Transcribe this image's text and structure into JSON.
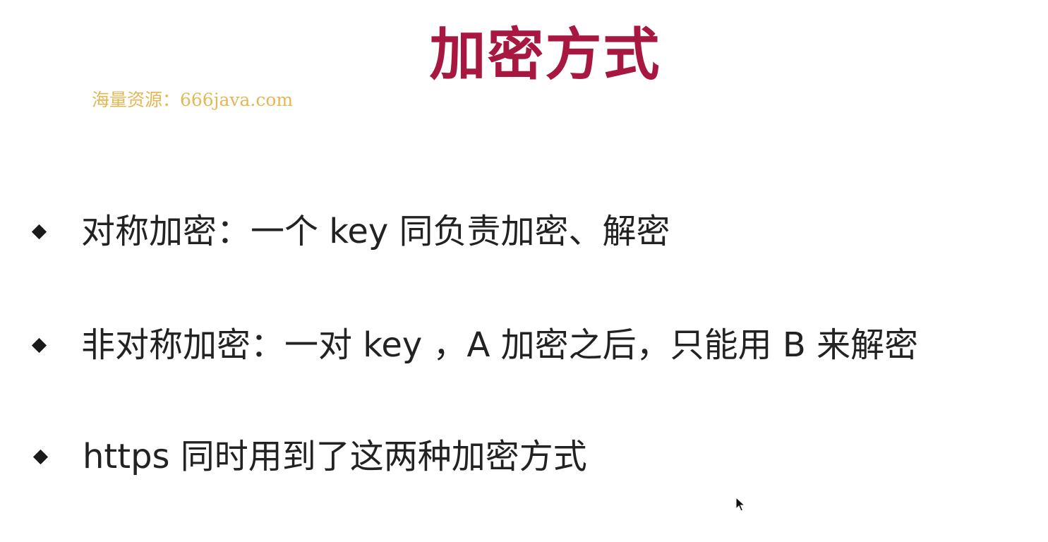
{
  "slide": {
    "title": "加密方式",
    "watermark": "海量资源：666java.com",
    "bullets": [
      {
        "text": "对称加密：一个 key 同负责加密、解密"
      },
      {
        "text": "非对称加密：一对 key ，A 加密之后，只能用 B 来解密"
      },
      {
        "text": "https 同时用到了这两种加密方式"
      }
    ],
    "bullet_icon": "diamond-bullet-icon",
    "cursor_icon": "mouse-pointer-icon"
  },
  "colors": {
    "title": "#a8173f",
    "watermark": "#e3b756",
    "text": "#222222",
    "background": "#ffffff"
  }
}
